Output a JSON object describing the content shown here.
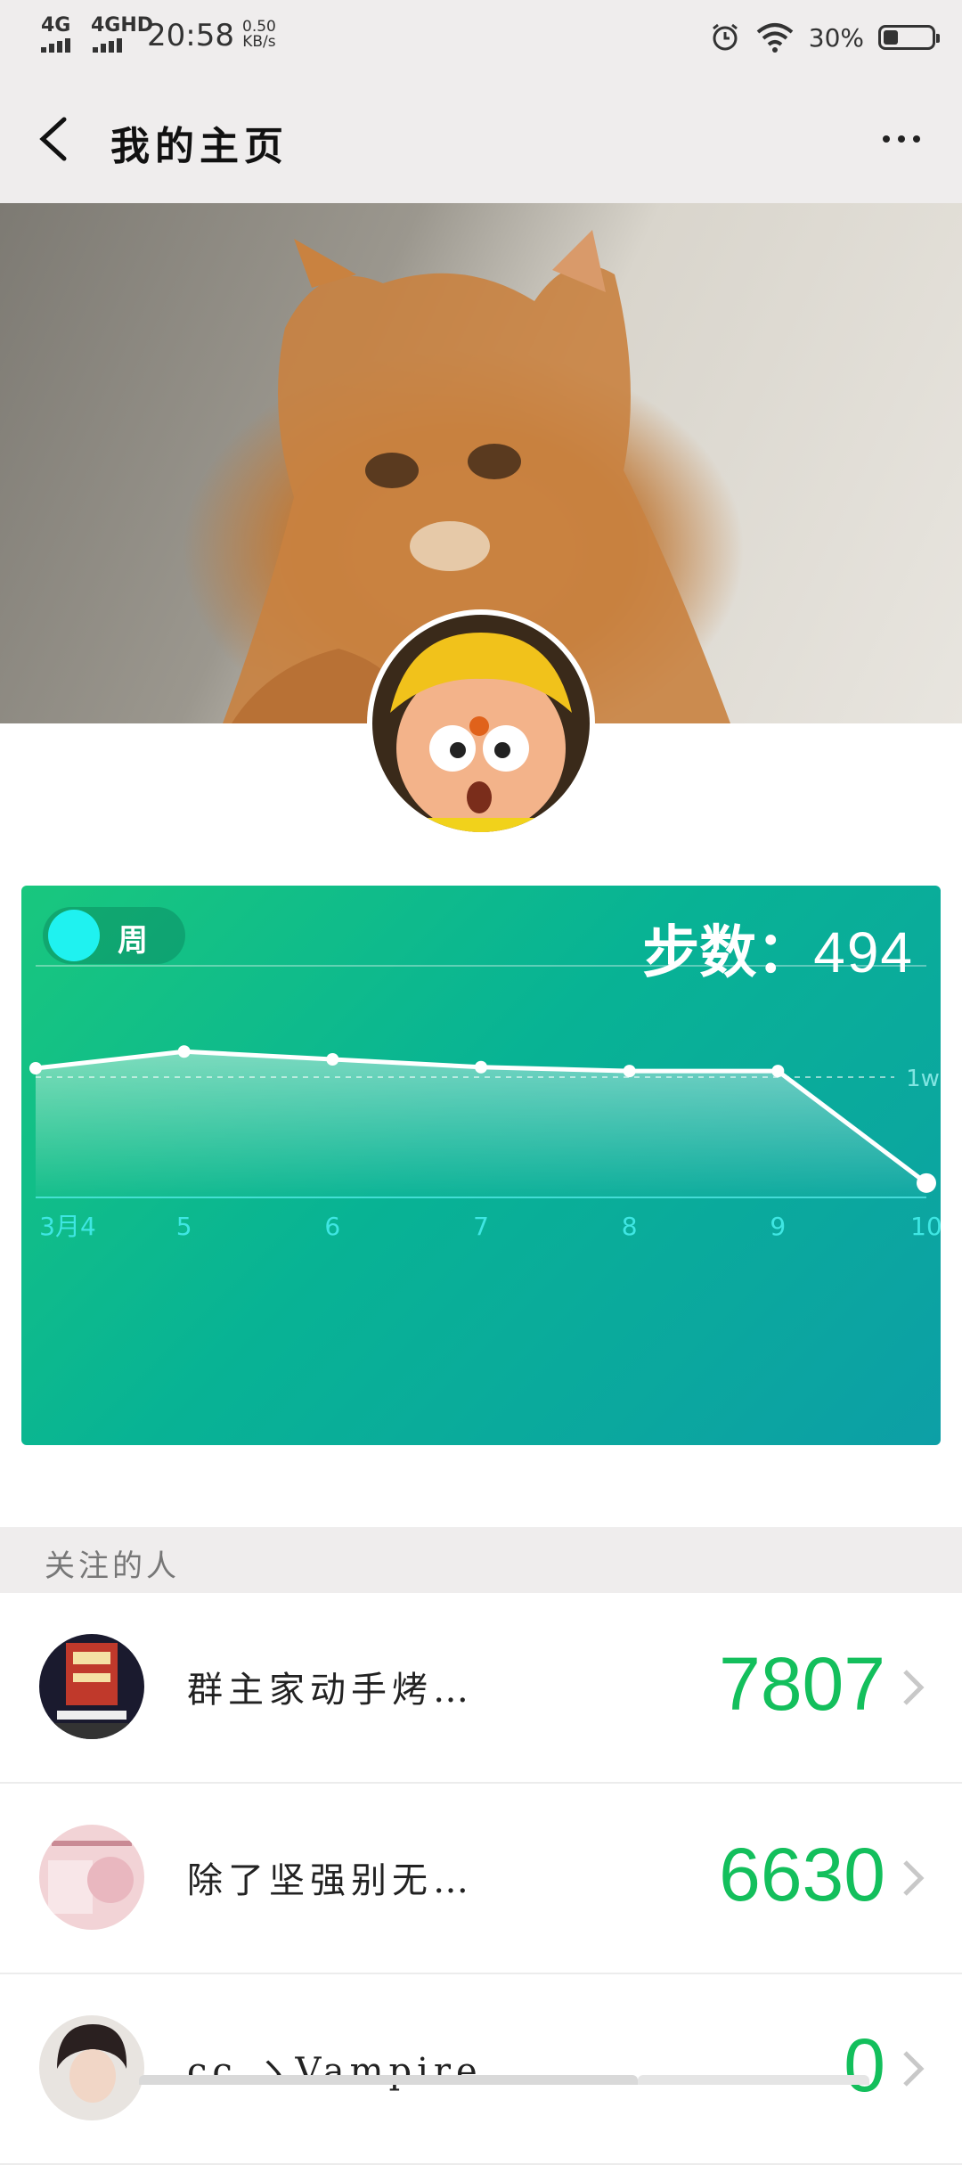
{
  "status_bar": {
    "net1": "4G",
    "net2": "4GHD",
    "time": "20:58",
    "speed_value": "0.50",
    "speed_unit": "KB/s",
    "battery_text": "30%",
    "battery_level": 0.3,
    "icons": [
      "signal-icon",
      "alarm-icon",
      "wifi-icon",
      "battery-icon"
    ]
  },
  "header": {
    "title": "我的主页",
    "back_icon": "chevron-left-icon",
    "more_icon": "more-dots-icon"
  },
  "chart_card": {
    "toggle_label": "周",
    "steps_prefix": "步数：",
    "steps_value": "494",
    "colors": {
      "line": "#ffffff",
      "gradient_start": "#19c77e",
      "gradient_end": "#0d9fa6",
      "tick_text": "#3fe6e3"
    }
  },
  "chart_data": {
    "type": "area",
    "categories": [
      "3月4",
      "5",
      "6",
      "7",
      "8",
      "9",
      "10"
    ],
    "values": [
      10800,
      12300,
      11600,
      10900,
      10550,
      10550,
      494
    ],
    "reference_line": {
      "value": 10000,
      "label": "1w"
    },
    "ylim": [
      -800,
      20000
    ],
    "grid": true
  },
  "following": {
    "section_title": "关注的人",
    "items": [
      {
        "name": "群主家动手烤…",
        "steps": "7807"
      },
      {
        "name": "除了坚强别无…",
        "steps": "6630"
      },
      {
        "name": "cc ゝVampire",
        "steps": "0"
      }
    ]
  }
}
